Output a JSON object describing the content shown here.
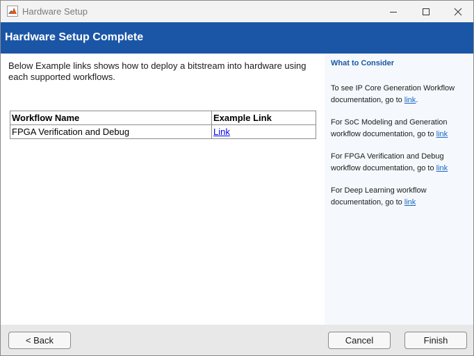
{
  "window": {
    "title": "Hardware Setup"
  },
  "header": {
    "title": "Hardware Setup Complete"
  },
  "main": {
    "intro": "Below Example links shows how to deploy a bitstream into hardware using each supported workflows.",
    "table": {
      "headers": [
        "Workflow Name",
        "Example Link"
      ],
      "rows": [
        {
          "workflow": "FPGA Verification and Debug",
          "link": "Link"
        }
      ]
    }
  },
  "side": {
    "heading": "What to Consider",
    "tips": [
      {
        "prefix": "To see IP Core Generation Workflow documentation, go to ",
        "link": "link",
        "suffix": "."
      },
      {
        "prefix": "For SoC Modeling and Generation workflow documentation, go to ",
        "link": "link",
        "suffix": ""
      },
      {
        "prefix": "For FPGA Verification and Debug workflow documentation, go to ",
        "link": "link",
        "suffix": ""
      },
      {
        "prefix": "For Deep Learning workflow documentation, go to ",
        "link": "link",
        "suffix": ""
      }
    ]
  },
  "footer": {
    "back": "< Back",
    "cancel": "Cancel",
    "finish": "Finish"
  },
  "icons": {
    "app": "matlab-icon",
    "minimize": "minimize-icon",
    "maximize": "maximize-icon",
    "close": "close-icon"
  },
  "colors": {
    "header": "#1b56a6",
    "side_panel": "#f5f9fd",
    "link": "#1766c2"
  }
}
